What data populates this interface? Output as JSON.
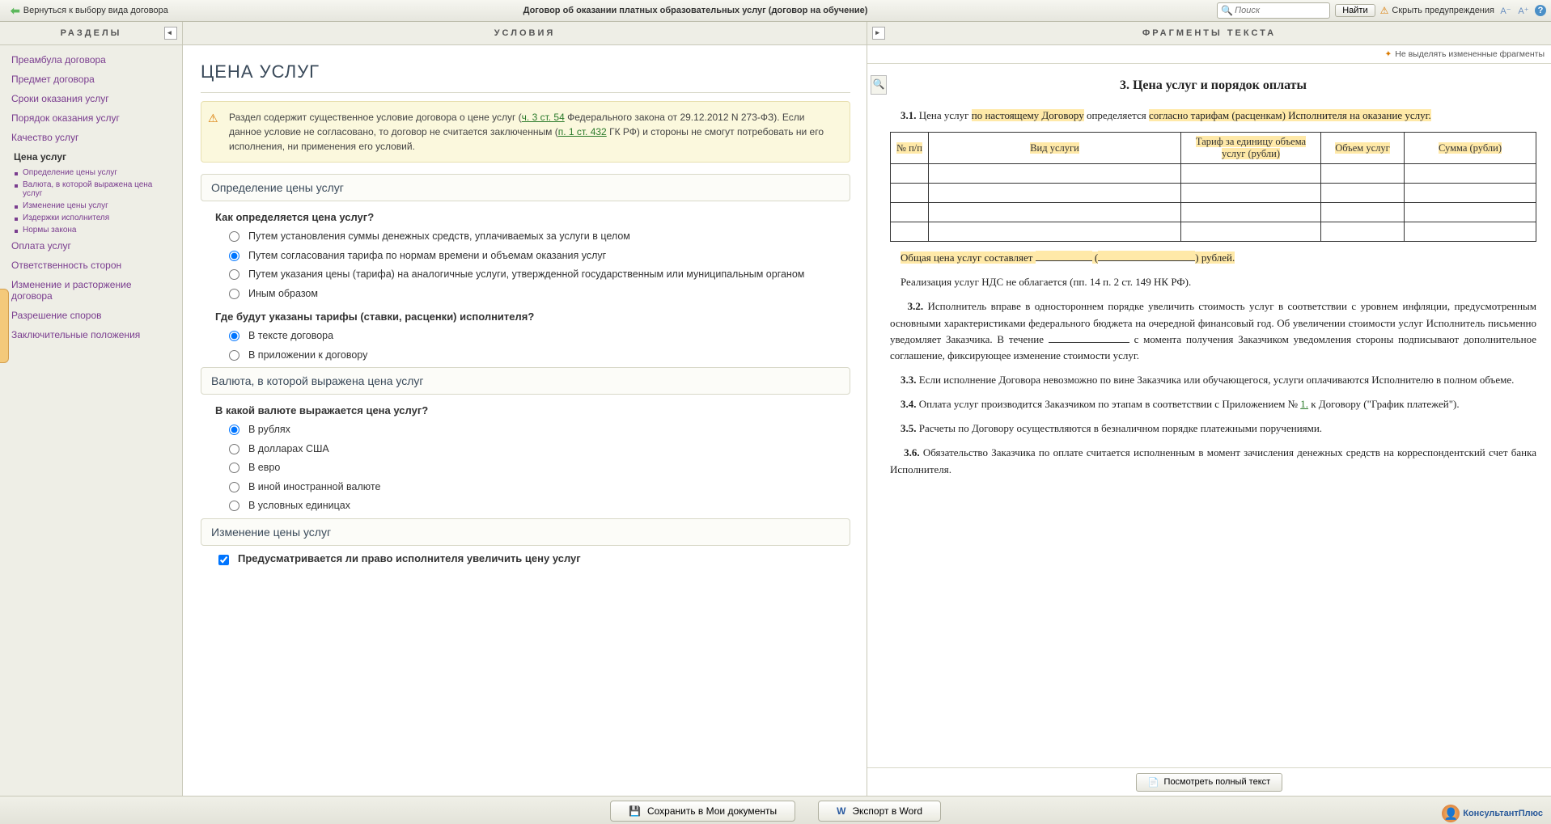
{
  "top": {
    "back": "Вернуться к выбору вида договора",
    "title": "Договор об оказании платных образовательных услуг (договор на обучение)",
    "search_ph": "Поиск",
    "find": "Найти",
    "hide_warn": "Скрыть предупреждения"
  },
  "cols": {
    "sections": "РАЗДЕЛЫ",
    "conditions": "УСЛОВИЯ",
    "fragments": "ФРАГМЕНТЫ ТЕКСТА"
  },
  "nav": {
    "items": [
      "Преамбула договора",
      "Предмет договора",
      "Сроки оказания услуг",
      "Порядок оказания услуг",
      "Качество услуг"
    ],
    "active": "Цена услуг",
    "subs": [
      "Определение цены услуг",
      "Валюта, в которой выражена цена услуг",
      "Изменение цены услуг",
      "Издержки исполнителя",
      "Нормы закона"
    ],
    "items2": [
      "Оплата услуг",
      "Ответственность сторон",
      "Изменение и расторжение договора",
      "Разрешение споров",
      "Заключительные положения"
    ]
  },
  "cond": {
    "heading": "ЦЕНА УСЛУГ",
    "warn_p1": "Раздел содержит существенное условие договора о цене услуг (",
    "warn_l1": "ч. 3 ст. 54",
    "warn_p2": " Федерального закона от 29.12.2012 N 273-ФЗ). Если данное условие не согласовано, то договор не считается заключенным (",
    "warn_l2": "п. 1 ст. 432",
    "warn_p3": " ГК РФ) и стороны не смогут потребовать ни его исполнения, ни применения его условий.",
    "s1": "Определение цены услуг",
    "q1": "Как определяется цена услуг?",
    "o1a": "Путем установления суммы денежных средств, уплачиваемых за услуги в целом",
    "o1b": "Путем согласования тарифа по нормам времени и объемам оказания услуг",
    "o1c": "Путем указания цены (тарифа) на аналогичные услуги, утвержденной государственным или муниципальным органом",
    "o1d": "Иным образом",
    "q2": "Где будут указаны тарифы (ставки, расценки) исполнителя?",
    "o2a": "В тексте договора",
    "o2b": "В приложении к договору",
    "s2": "Валюта, в которой выражена цена услуг",
    "q3": "В какой валюте  выражается цена услуг?",
    "o3a": "В рублях",
    "o3b": "В долларах США",
    "o3c": "В евро",
    "o3d": "В иной иностранной валюте",
    "o3e": "В условных единицах",
    "s3": "Изменение цены услуг",
    "q4": "Предусматривается ли право исполнителя увеличить цену услуг"
  },
  "frag": {
    "toolbar": "Не выделять измененные фрагменты",
    "h": "3. Цена услуг и порядок оплаты",
    "p31a": "3.1.",
    "p31b": " Цена услуг ",
    "p31c": "по настоящему Договору",
    "p31d": " определяется ",
    "p31e": "согласно тарифам (расценкам) Исполнителя на оказание услуг.",
    "th1": "№ п/п",
    "th2": "Вид услуги",
    "th3": "Тариф за единицу объема услуг (рубли)",
    "th4": "Объем услуг",
    "th5": "Сумма (рубли)",
    "total_a": "Общая цена услуг составляет ",
    "total_b": " (",
    "total_c": ") рублей.",
    "nds": "Реализация услуг НДС не облагается (пп. 14 п. 2 ст. 149 НК РФ).",
    "p32n": "3.2.",
    "p32": " Исполнитель вправе в одностороннем порядке увеличить стоимость услуг в соответствии с уровнем инфляции, предусмотренным основными характеристиками федерального бюджета на очередной финансовый год. Об увеличении стоимости услуг Исполнитель письменно уведомляет Заказчика. В течение ",
    "p32b": " с момента получения Заказчиком уведомления стороны подписывают дополнительное соглашение, фиксирующее изменение стоимости услуг.",
    "p33n": "3.3.",
    "p33": " Если исполнение Договора невозможно по вине Заказчика или обучающегося, услуги оплачиваются Исполнителю в полном объеме.",
    "p34n": "3.4.",
    "p34a": " Оплата услуг производится Заказчиком по этапам в соответствии с Приложением № ",
    "p34l": "1.",
    "p34b": " к Договору (\"График платежей\").",
    "p35n": "3.5.",
    "p35": " Расчеты по Договору осуществляются в безналичном порядке платежными поручениями.",
    "p36n": "3.6.",
    "p36": " Обязательство Заказчика по оплате считается исполненным в момент зачисления денежных средств на корреспондентский счет банка Исполнителя.",
    "view_full": "Посмотреть полный текст"
  },
  "bottom": {
    "save": "Сохранить в Мои документы",
    "export": "Экспорт в Word",
    "brand": "КонсультантПлюс"
  }
}
